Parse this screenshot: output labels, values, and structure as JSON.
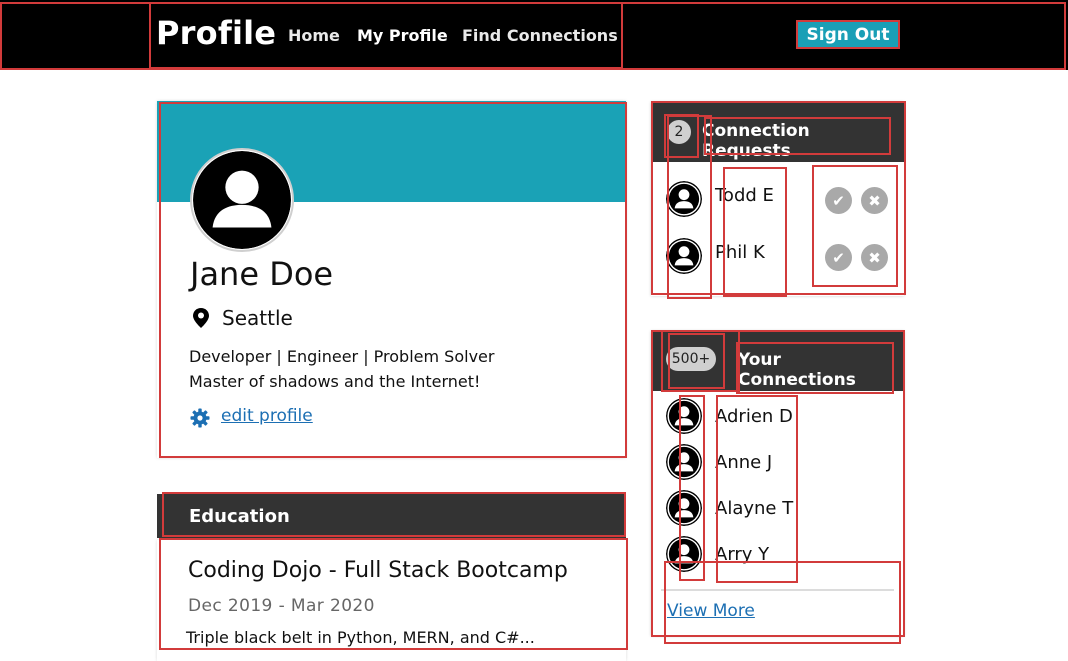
{
  "header": {
    "brand": "Profile",
    "nav": {
      "home": "Home",
      "my_profile": "My Profile",
      "find_connections": "Find Connections"
    },
    "sign_out": "Sign Out"
  },
  "profile": {
    "name": "Jane Doe",
    "location": "Seattle",
    "bio_line1": "Developer | Engineer | Problem Solver",
    "bio_line2": "Master of shadows and the Internet!",
    "edit_label": "edit profile"
  },
  "education": {
    "header": "Education",
    "items": [
      {
        "title": "Coding Dojo - Full Stack Bootcamp",
        "dates": "Dec 2019 - Mar 2020",
        "description": "Triple black belt in Python, MERN, and C#..."
      }
    ]
  },
  "requests": {
    "count": "2",
    "title": "Connection Requests",
    "people": [
      {
        "name": "Todd E"
      },
      {
        "name": "Phil K"
      }
    ]
  },
  "connections": {
    "count": "500+",
    "title": "Your Connections",
    "people": [
      {
        "name": "Adrien D"
      },
      {
        "name": "Anne J"
      },
      {
        "name": "Alayne T"
      },
      {
        "name": "Arry Y"
      }
    ],
    "view_more": "View More"
  },
  "colors": {
    "accent": "#1aa2b6",
    "nav_bg": "#000000",
    "panel_header": "#333333",
    "link": "#1c6fb3",
    "annotation": "#d23b3b"
  },
  "icons": [
    "avatar-icon",
    "map-pin-icon",
    "gear-icon",
    "check-icon",
    "close-icon"
  ]
}
